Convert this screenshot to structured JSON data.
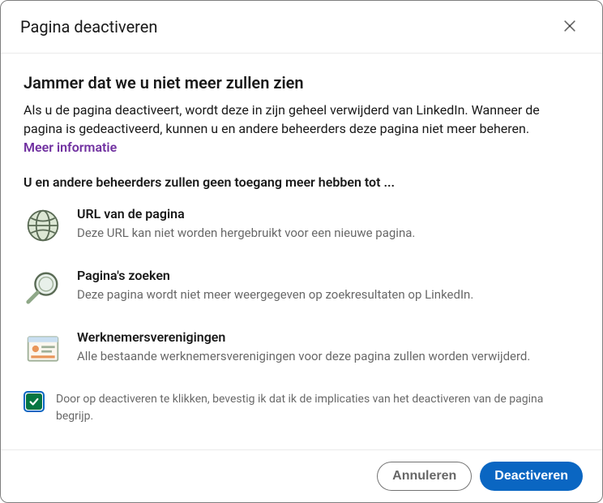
{
  "header": {
    "title": "Pagina deactiveren"
  },
  "body": {
    "headline": "Jammer dat we u niet meer zullen zien",
    "description": "Als u de pagina deactiveert, wordt deze in zijn geheel verwijderd van LinkedIn. Wanneer de pagina is gedeactiveerd, kunnen u en andere beheerders deze pagina niet meer beheren.",
    "learn_more": "Meer informatie",
    "subheadline": "U en andere beheerders zullen geen toegang meer hebben tot ...",
    "items": [
      {
        "icon": "globe-icon",
        "title": "URL van de pagina",
        "desc": "Deze URL kan niet worden hergebruikt voor een nieuwe pagina."
      },
      {
        "icon": "magnifier-icon",
        "title": "Pagina's zoeken",
        "desc": "Deze pagina wordt niet meer weergegeven op zoekresultaten op LinkedIn."
      },
      {
        "icon": "profile-card-icon",
        "title": "Werknemersverenigingen",
        "desc": "Alle bestaande werknemersverenigingen voor deze pagina zullen worden verwijderd."
      }
    ],
    "confirm": {
      "checked": true,
      "label": "Door op deactiveren te klikken, bevestig ik dat ik de implicaties van het deactiveren van de pagina begrijp."
    }
  },
  "footer": {
    "cancel": "Annuleren",
    "deactivate": "Deactiveren"
  }
}
